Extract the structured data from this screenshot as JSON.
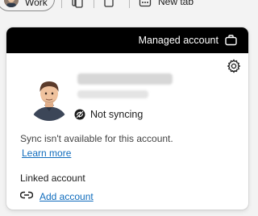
{
  "tabstrip": {
    "profile_label": "Work",
    "new_tab_label": "New tab"
  },
  "flyout": {
    "banner_label": "Managed account",
    "sync_status": "Not syncing",
    "sync_message": "Sync isn't available for this account.",
    "learn_more": "Learn more",
    "linked_title": "Linked account",
    "add_account": "Add account"
  },
  "icons": {
    "banner": "briefcase-icon",
    "settings": "gear-icon",
    "sync": "sync-off-icon",
    "linked": "link-icon"
  },
  "colors": {
    "banner_bg": "#000000",
    "link": "#0f6cbd"
  }
}
